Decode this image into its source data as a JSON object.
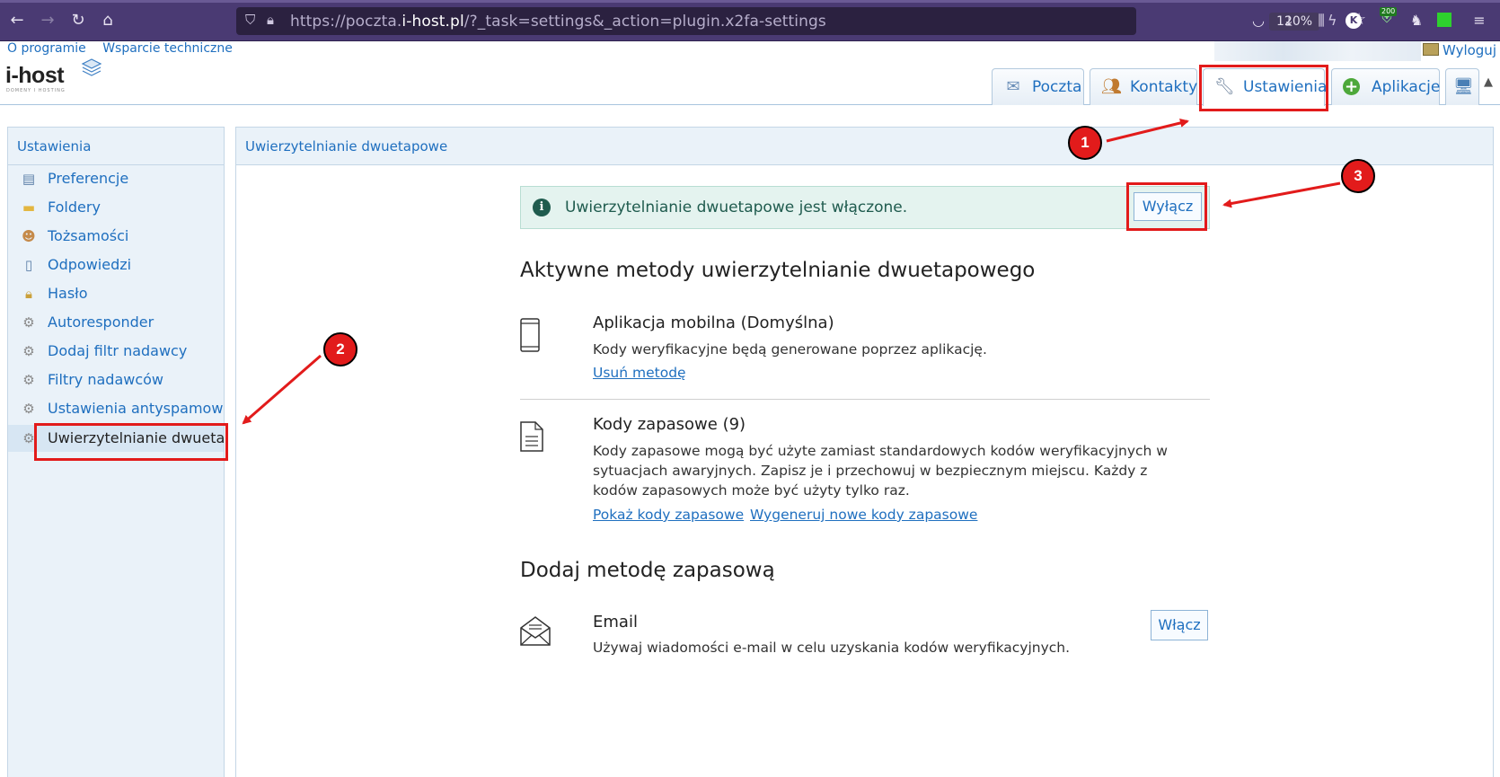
{
  "browser": {
    "url_prefix": "https://poczta.",
    "url_domain": "i-host.pl",
    "url_rest": "/?_task=settings&_action=plugin.x2fa-settings",
    "zoom": "120%",
    "badge_count": "200",
    "avatar_letter": "K"
  },
  "header": {
    "links": [
      "O programie",
      "Wsparcie techniczne"
    ],
    "logo_text": "i-host",
    "logo_sub": "DOMENY I HOSTING",
    "logout": "Wyloguj"
  },
  "tabs": [
    {
      "label": "Poczta",
      "icon": "mail-icon"
    },
    {
      "label": "Kontakty",
      "icon": "contacts-icon"
    },
    {
      "label": "Ustawienia",
      "icon": "wrench-icon"
    },
    {
      "label": "Aplikacje",
      "icon": "plus-circle-icon"
    }
  ],
  "sidebar": {
    "title": "Ustawienia",
    "items": [
      {
        "label": "Preferencje",
        "icon": "preferences-icon"
      },
      {
        "label": "Foldery",
        "icon": "folder-icon"
      },
      {
        "label": "Tożsamości",
        "icon": "person-icon"
      },
      {
        "label": "Odpowiedzi",
        "icon": "document-icon"
      },
      {
        "label": "Hasło",
        "icon": "lock-icon"
      },
      {
        "label": "Autoresponder",
        "icon": "gear-icon"
      },
      {
        "label": "Dodaj filtr nadawcy",
        "icon": "gear-icon"
      },
      {
        "label": "Filtry nadawców",
        "icon": "gear-icon"
      },
      {
        "label": "Ustawienia antyspamowe",
        "icon": "gear-icon"
      },
      {
        "label": "Uwierzytelnianie dwuetap",
        "icon": "gear-icon"
      }
    ]
  },
  "main": {
    "title": "Uwierzytelnianie dwuetapowe",
    "notice": "Uwierzytelnianie dwuetapowe jest włączone.",
    "disable_button": "Wyłącz",
    "active_heading": "Aktywne metody uwierzytelnianie dwuetapowego",
    "mobile": {
      "title": "Aplikacja mobilna (Domyślna)",
      "desc": "Kody weryfikacyjne będą generowane poprzez aplikację.",
      "remove_link": "Usuń metodę"
    },
    "backup": {
      "title": "Kody zapasowe (9)",
      "desc": "Kody zapasowe mogą być użyte zamiast standardowych kodów weryfikacyjnych w sytuacjach awaryjnych. Zapisz je i przechowuj w bezpiecznym miejscu. Każdy z kodów zapasowych może być użyty tylko raz.",
      "show_link": "Pokaż kody zapasowe",
      "regen_link": "Wygeneruj nowe kody zapasowe"
    },
    "add_heading": "Dodaj metodę zapasową",
    "email": {
      "title": "Email",
      "desc": "Używaj wiadomości e-mail w celu uzyskania kodów weryfikacyjnych.",
      "enable_button": "Włącz"
    }
  },
  "annotations": [
    "1",
    "2",
    "3"
  ],
  "colors": {
    "accent": "#1f6fbf",
    "annotation": "#e21b1b",
    "browser": "#4a3a73",
    "notice_bg": "#e4f3ef"
  }
}
